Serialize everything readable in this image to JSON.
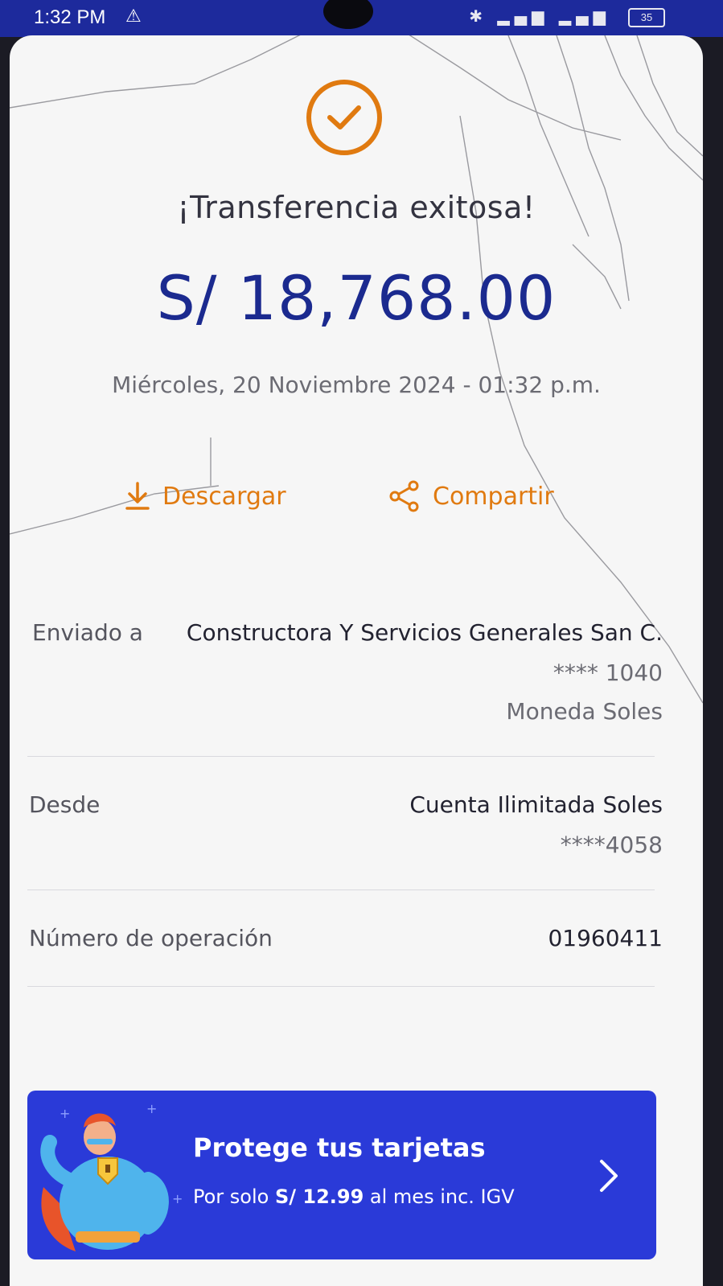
{
  "status_bar": {
    "time": "1:32 PM",
    "battery": "35",
    "icons": [
      "warning-icon",
      "bluetooth-icon",
      "signal-icon",
      "signal-icon",
      "battery-icon"
    ]
  },
  "receipt": {
    "title": "¡Transferencia exitosa!",
    "amount": "S/ 18,768.00",
    "datetime": "Miércoles, 20 Noviembre 2024 - 01:32 p.m.",
    "actions": {
      "download": "Descargar",
      "share": "Compartir"
    },
    "sent_to": {
      "label": "Enviado a",
      "name": "Constructora Y Servicios Generales San C.",
      "account": "**** 1040",
      "currency": "Moneda Soles"
    },
    "from": {
      "label": "Desde",
      "account_name": "Cuenta Ilimitada Soles",
      "account": "****4058"
    },
    "operation": {
      "label": "Número de operación",
      "number": "01960411"
    }
  },
  "promo": {
    "title": "Protege tus tarjetas",
    "subtitle_prefix": "Por solo ",
    "price": "S/ 12.99",
    "subtitle_suffix": " al mes inc. IGV"
  },
  "colors": {
    "brand_blue": "#1b2a8f",
    "accent_orange": "#e07a10",
    "promo_blue": "#2a3ad8",
    "status_bar": "#1d2a9c"
  }
}
